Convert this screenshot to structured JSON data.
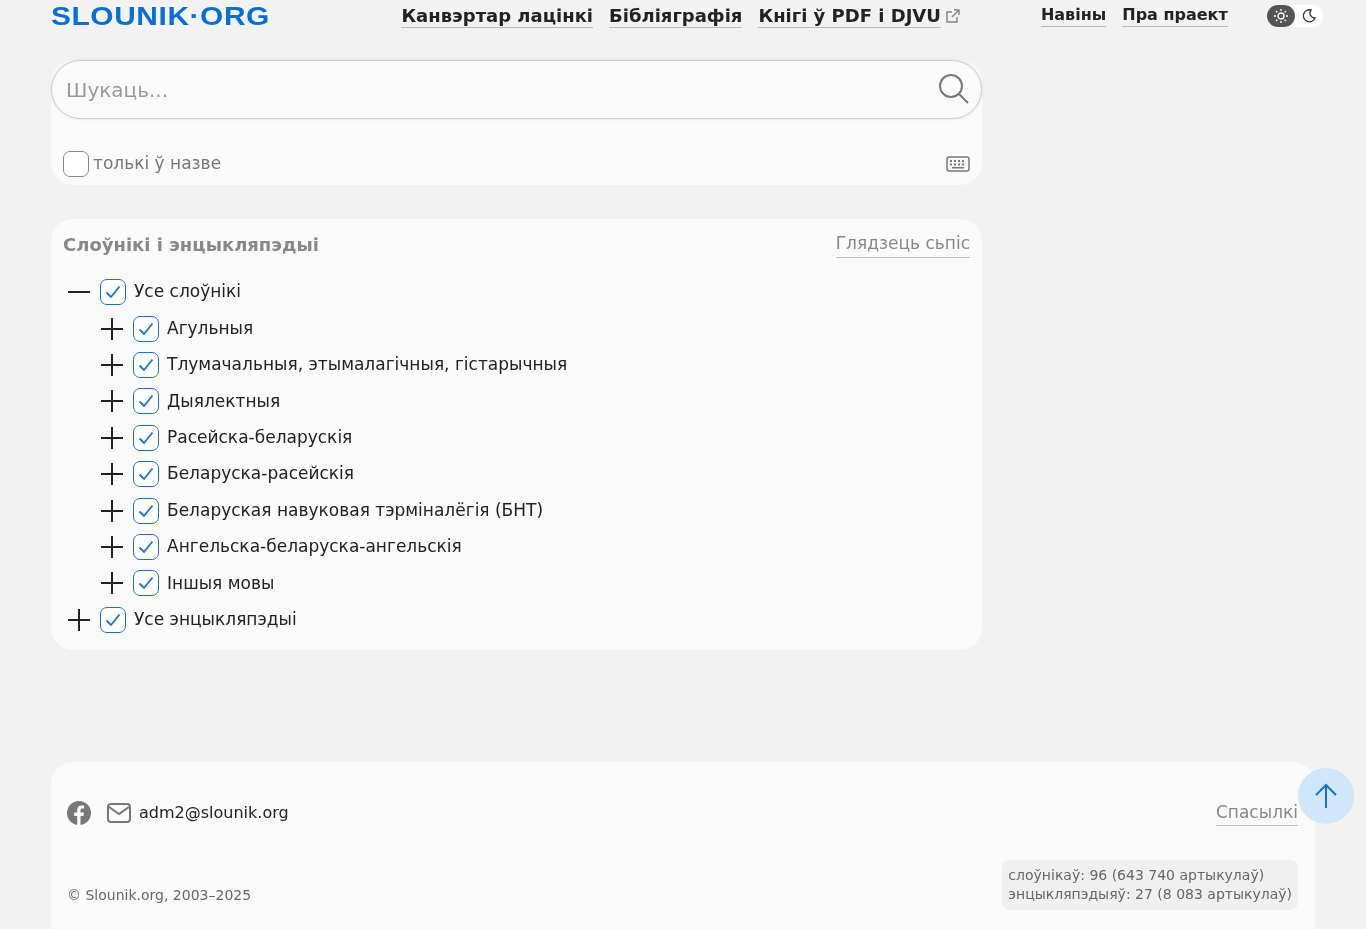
{
  "header": {
    "logo": "SLOUNIK·ORG",
    "nav": [
      {
        "label": "Канвэртар лацінкі",
        "external": false
      },
      {
        "label": "Бібліяграфія",
        "external": false
      },
      {
        "label": "Кнігі ў PDF і DJVU",
        "external": true
      }
    ],
    "nav_right": [
      "Навіны",
      "Пра праект"
    ],
    "theme": [
      {
        "kind": "light",
        "selected": true
      },
      {
        "kind": "dark",
        "selected": false
      }
    ]
  },
  "search": {
    "placeholder": "Шукаць...",
    "title_only": {
      "label": "толькі ў назве",
      "checked": false
    }
  },
  "sources": {
    "title": "Слоўнікі і энцыкляпэдыі",
    "link": "Глядзець сьпіс",
    "tree": [
      {
        "label": "Усе слоўнікі",
        "checked": true,
        "expanded": true,
        "children": [
          {
            "label": "Агульныя",
            "checked": true,
            "expanded": false
          },
          {
            "label": "Тлумачальныя, этымалагічныя, гістарычныя",
            "checked": true,
            "expanded": false
          },
          {
            "label": "Дыялектныя",
            "checked": true,
            "expanded": false
          },
          {
            "label": "Расейска-беларускія",
            "checked": true,
            "expanded": false
          },
          {
            "label": "Беларуска-расейскія",
            "checked": true,
            "expanded": false
          },
          {
            "label": "Беларуская навуковая тэрміналёгія (БНТ)",
            "checked": true,
            "expanded": false
          },
          {
            "label": "Ангельска-беларуска-ангельскія",
            "checked": true,
            "expanded": false
          },
          {
            "label": "Іншыя мовы",
            "checked": true,
            "expanded": false
          }
        ]
      },
      {
        "label": "Усе энцыкляпэдыі",
        "checked": true,
        "expanded": false
      }
    ]
  },
  "footer": {
    "email": "adm2@slounik.org",
    "links": "Спасылкі",
    "copyright": "© Slounik.org, 2003–2025",
    "stats": [
      "слоўнікаў: 96 (643 740 артыкулаў)",
      "энцыкляпэдыяў: 27 (8 083 артыкулаў)"
    ]
  }
}
